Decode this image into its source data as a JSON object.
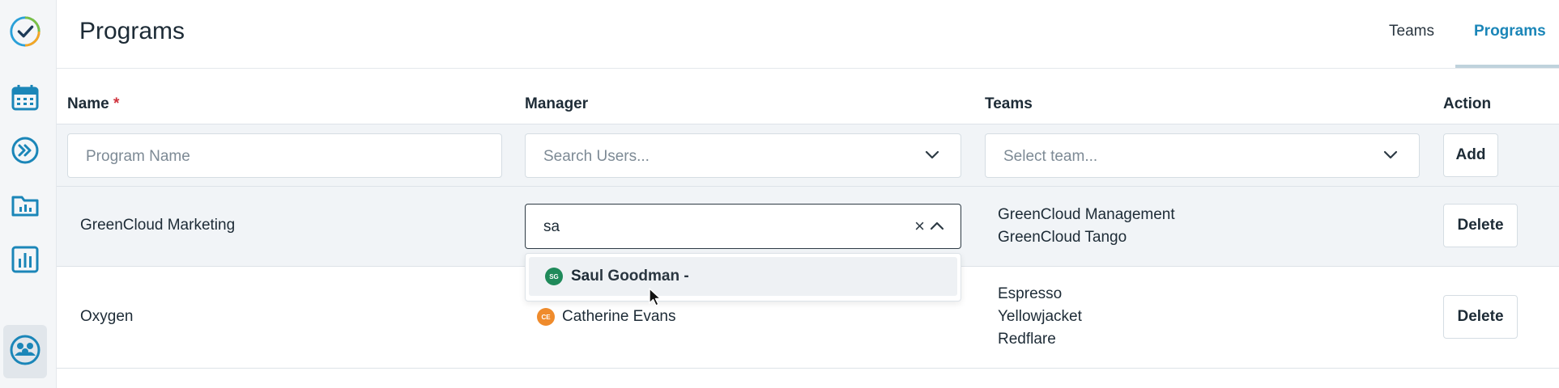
{
  "header": {
    "title": "Programs",
    "tabs": [
      {
        "label": "Teams",
        "active": false
      },
      {
        "label": "Programs",
        "active": true
      }
    ]
  },
  "sidebar": {
    "items": [
      "logo-icon",
      "calendar-icon",
      "forward-icon",
      "folder-chart-icon",
      "bar-chart-icon",
      "teams-icon"
    ]
  },
  "table": {
    "columns": {
      "name": "Name",
      "required_mark": "*",
      "manager": "Manager",
      "teams": "Teams",
      "action": "Action"
    },
    "new_row": {
      "name_placeholder": "Program Name",
      "manager_placeholder": "Search Users...",
      "teams_placeholder": "Select team...",
      "add_label": "Add"
    },
    "rows": [
      {
        "name": "GreenCloud Marketing",
        "manager_search": "sa",
        "teams": [
          "GreenCloud Management",
          "GreenCloud Tango"
        ],
        "action": "Delete"
      },
      {
        "name": "Oxygen",
        "manager": {
          "initials": "CE",
          "name": "Catherine Evans"
        },
        "teams": [
          "Espresso",
          "Yellowjacket",
          "Redflare"
        ],
        "action": "Delete"
      }
    ]
  },
  "dropdown": {
    "options": [
      {
        "initials": "SG",
        "match": "Sa",
        "rest": "ul Goodman -"
      }
    ]
  },
  "colors": {
    "accent": "#1b86b8",
    "required": "#d0333d",
    "avatar_sg": "#1f8a5a",
    "avatar_ce": "#ef8b2c"
  }
}
